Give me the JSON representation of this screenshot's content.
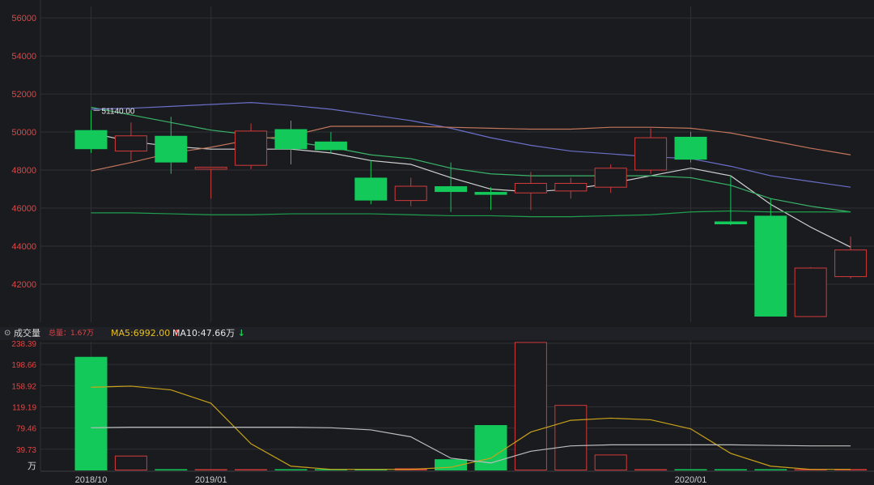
{
  "colors": {
    "background": "#1a1b1f",
    "grid": "#2e3036",
    "axis_label": "#e04545",
    "date_label": "#cfcfcf",
    "up": "#d23a3a",
    "down": "#12c95a",
    "ma_white": "#d0d0d0",
    "ma_green": "#3ab56a",
    "ma_blue": "#6a6fc8",
    "ma_orange": "#c2755a",
    "ma_darkgreen": "#1f9f4f",
    "vol_ma5": "#c9a21a",
    "vol_ma10": "#bdbdbd"
  },
  "volume_panel": {
    "icon": "⊙",
    "label": "成交量",
    "total": "总量：1.67万",
    "ma5": "MA5:6992.00",
    "ma5_arrow": "↑",
    "ma10": "MA10:47.66万",
    "ma10_arrow": "↓"
  },
  "chart_data": [
    {
      "type": "candlestick",
      "y_ticks": [
        "56000",
        "54000",
        "52000",
        "50000",
        "48000",
        "46000",
        "44000",
        "42000"
      ],
      "ylim": [
        40000,
        56600
      ],
      "x_labels": [
        {
          "index": 0,
          "text": "2018/10"
        },
        {
          "index": 3,
          "text": "2019/01"
        },
        {
          "index": 15,
          "text": "2020/01"
        }
      ],
      "max_annotation": "51140.00",
      "candles": [
        {
          "open": 50100,
          "high": 51140,
          "low": 48900,
          "close": 49100,
          "dir": "down"
        },
        {
          "open": 49000,
          "high": 50500,
          "low": 48500,
          "close": 49800,
          "dir": "up"
        },
        {
          "open": 49800,
          "high": 50800,
          "low": 47800,
          "close": 48400,
          "dir": "down"
        },
        {
          "open": 48050,
          "high": 48150,
          "low": 46500,
          "close": 48150,
          "dir": "up"
        },
        {
          "open": 48250,
          "high": 50450,
          "low": 48050,
          "close": 50050,
          "dir": "up"
        },
        {
          "open": 50150,
          "high": 50600,
          "low": 48300,
          "close": 49100,
          "dir": "down"
        },
        {
          "open": 49500,
          "high": 50000,
          "low": 48900,
          "close": 49050,
          "dir": "down"
        },
        {
          "open": 47600,
          "high": 48500,
          "low": 46200,
          "close": 46400,
          "dir": "down"
        },
        {
          "open": 46400,
          "high": 47600,
          "low": 46100,
          "close": 47150,
          "dir": "up"
        },
        {
          "open": 47150,
          "high": 48400,
          "low": 45800,
          "close": 46850,
          "dir": "down"
        },
        {
          "open": 46850,
          "high": 47100,
          "low": 45900,
          "close": 46700,
          "dir": "down"
        },
        {
          "open": 46800,
          "high": 47900,
          "low": 45900,
          "close": 47300,
          "dir": "up"
        },
        {
          "open": 46900,
          "high": 47600,
          "low": 46500,
          "close": 47300,
          "dir": "up"
        },
        {
          "open": 47100,
          "high": 48300,
          "low": 46800,
          "close": 48100,
          "dir": "up"
        },
        {
          "open": 48000,
          "high": 50200,
          "low": 47800,
          "close": 49700,
          "dir": "up"
        },
        {
          "open": 49750,
          "high": 50000,
          "low": 48400,
          "close": 48550,
          "dir": "down"
        },
        {
          "open": 45300,
          "high": 47700,
          "low": 45100,
          "close": 45150,
          "dir": "down"
        },
        {
          "open": 45600,
          "high": 46500,
          "low": 40300,
          "close": 40300,
          "dir": "down"
        },
        {
          "open": 40300,
          "high": 42900,
          "low": 40300,
          "close": 42850,
          "dir": "up"
        },
        {
          "open": 42400,
          "high": 44500,
          "low": 42300,
          "close": 43800,
          "dir": "up"
        }
      ],
      "ma_series": [
        {
          "color_key": "ma_white",
          "values": [
            49950,
            49500,
            49250,
            49100,
            49100,
            49100,
            48900,
            48500,
            48300,
            47600,
            47000,
            46850,
            47000,
            47300,
            47700,
            48100,
            47700,
            46200,
            45000,
            43950
          ]
        },
        {
          "color_key": "ma_green",
          "values": [
            51300,
            50900,
            50500,
            50100,
            49850,
            49500,
            49200,
            48800,
            48600,
            48100,
            47800,
            47700,
            47700,
            47700,
            47700,
            47600,
            47200,
            46500,
            46100,
            45800
          ]
        },
        {
          "color_key": "ma_blue",
          "values": [
            51200,
            51250,
            51350,
            51450,
            51550,
            51400,
            51200,
            50900,
            50600,
            50200,
            49700,
            49300,
            49000,
            48850,
            48700,
            48600,
            48200,
            47700,
            47400,
            47100
          ]
        },
        {
          "color_key": "ma_orange",
          "values": [
            47950,
            48400,
            48900,
            49200,
            49600,
            49800,
            50300,
            50300,
            50300,
            50250,
            50200,
            50150,
            50150,
            50250,
            50250,
            50200,
            49950,
            49550,
            49150,
            48800
          ]
        },
        {
          "color_key": "ma_darkgreen",
          "values": [
            45750,
            45750,
            45700,
            45650,
            45650,
            45700,
            45700,
            45700,
            45650,
            45600,
            45600,
            45550,
            45550,
            45600,
            45650,
            45800,
            45850,
            45800,
            45800,
            45800
          ]
        }
      ]
    },
    {
      "type": "bar",
      "y_ticks": [
        "238.39",
        "198.66",
        "158.92",
        "119.19",
        "79.46",
        "39.73"
      ],
      "unit": "万",
      "ylim": [
        0,
        238.39
      ],
      "volumes": [
        {
          "value": 213,
          "dir": "down"
        },
        {
          "value": 27,
          "dir": "up"
        },
        {
          "value": 1.5,
          "dir": "down"
        },
        {
          "value": 1.5,
          "dir": "up"
        },
        {
          "value": 1.5,
          "dir": "up"
        },
        {
          "value": 1.5,
          "dir": "down"
        },
        {
          "value": 1.5,
          "dir": "down"
        },
        {
          "value": 2.5,
          "dir": "down"
        },
        {
          "value": 4,
          "dir": "up"
        },
        {
          "value": 21,
          "dir": "down"
        },
        {
          "value": 85,
          "dir": "down"
        },
        {
          "value": 240,
          "dir": "up"
        },
        {
          "value": 122,
          "dir": "up"
        },
        {
          "value": 29,
          "dir": "up"
        },
        {
          "value": 1.5,
          "dir": "up"
        },
        {
          "value": 1.5,
          "dir": "down"
        },
        {
          "value": 1.5,
          "dir": "down"
        },
        {
          "value": 1.5,
          "dir": "down"
        },
        {
          "value": 1.5,
          "dir": "up"
        },
        {
          "value": 2.5,
          "dir": "up"
        }
      ],
      "ma5_values": [
        156,
        158,
        151,
        126,
        50,
        8,
        2,
        2,
        2,
        6,
        23,
        72,
        94,
        98,
        95,
        78,
        32,
        8,
        2,
        2
      ],
      "ma10_values": [
        80,
        81,
        81,
        81,
        81,
        81,
        80,
        76,
        63,
        23,
        14,
        36,
        46,
        48,
        48,
        48,
        48,
        47,
        46,
        46
      ]
    }
  ]
}
